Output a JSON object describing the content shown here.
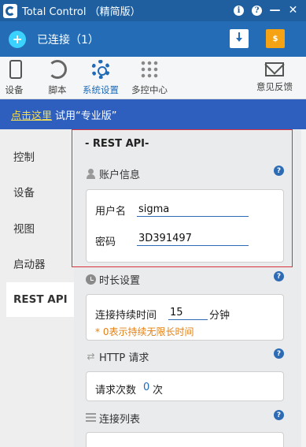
{
  "window": {
    "title": "Total Control （精简版）",
    "info_glyph": "i",
    "help_glyph": "?",
    "minimize_glyph": "—",
    "close_glyph": "✕"
  },
  "status": {
    "connected_text": "已连接（1）",
    "cart_glyph": "$"
  },
  "toolbar": {
    "items": [
      {
        "label": "设备",
        "icon": "phone-icon"
      },
      {
        "label": "脚本",
        "icon": "script-icon"
      },
      {
        "label": "系统设置",
        "icon": "gear-icon",
        "active": true
      },
      {
        "label": "多控中心",
        "icon": "grid-icon"
      },
      {
        "label": "意见反馈",
        "icon": "mail-icon"
      }
    ]
  },
  "promo": {
    "link_text": "点击这里",
    "text": "试用“专业版”"
  },
  "sidebar": {
    "items": [
      "控制",
      "设备",
      "视图",
      "启动器",
      "REST API"
    ],
    "active": "REST API"
  },
  "rest_api": {
    "title": "- REST API-",
    "account": {
      "header": "账户信息",
      "username_label": "用户名",
      "username_value": "sigma",
      "password_label": "密码",
      "password_value": "3D391497"
    },
    "duration": {
      "header": "时长设置",
      "label": "连接持续时间",
      "value": "15",
      "unit": "分钟",
      "note": "* 0表示持续无限长时间"
    },
    "http": {
      "header": "HTTP 请求",
      "label": "请求次数",
      "count": "0",
      "unit": "次"
    },
    "connections": {
      "header": "连接列表"
    }
  },
  "colors": {
    "titlebar": "#1f5fa0",
    "statusbar": "#246db6",
    "promo": "#2e5fbe",
    "promo_link": "#f6df52",
    "accent": "#1f6bb7",
    "note": "#e28016",
    "highlight": "#d8323a"
  }
}
